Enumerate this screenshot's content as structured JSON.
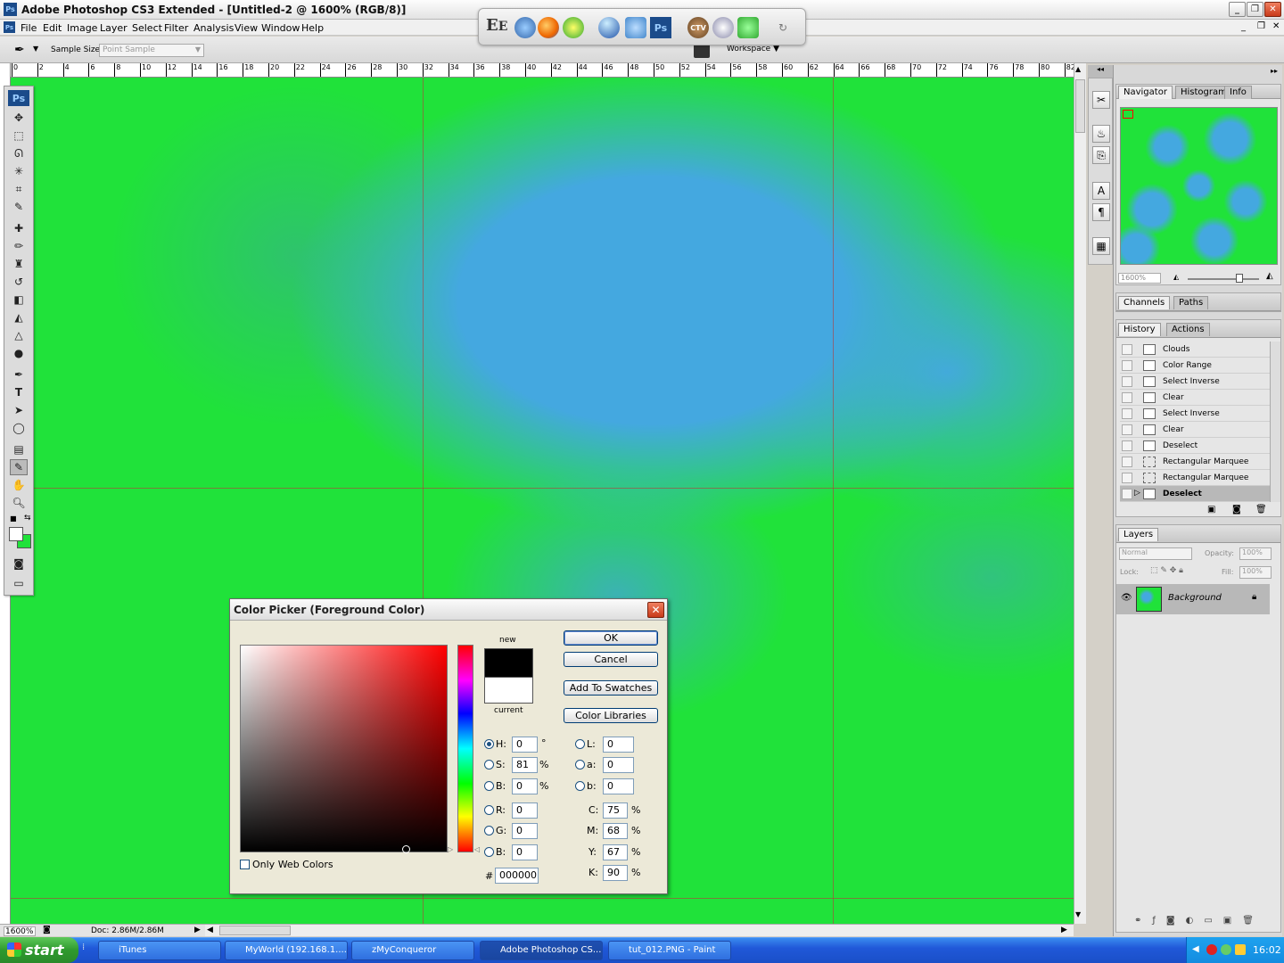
{
  "window": {
    "title": "Adobe Photoshop CS3 Extended - [Untitled-2 @ 1600% (RGB/8)]",
    "app_badge": "Ps"
  },
  "menu": [
    "File",
    "Edit",
    "Image",
    "Layer",
    "Select",
    "Filter",
    "Analysis",
    "View",
    "Window",
    "Help"
  ],
  "options": {
    "sample_size_label": "Sample Size:",
    "sample_size_value": "Point Sample",
    "workspace_label": "Workspace"
  },
  "quicklaunch": {
    "label": "Ps",
    "ctv": "CTV"
  },
  "ruler": {
    "marks": [
      "0",
      "2",
      "4",
      "6",
      "8",
      "10",
      "12",
      "14",
      "16",
      "18",
      "20",
      "22",
      "24",
      "26",
      "28",
      "30",
      "32",
      "34",
      "36",
      "38",
      "40",
      "42",
      "44",
      "46",
      "48",
      "50",
      "52",
      "54",
      "56",
      "58",
      "60",
      "62",
      "64",
      "66",
      "68",
      "70",
      "72",
      "74",
      "76",
      "78",
      "80",
      "82"
    ]
  },
  "canvas": {
    "colors": {
      "green": "#20e23a",
      "blue": "#44a8e0"
    }
  },
  "status": {
    "zoom": "1600%",
    "doc": "Doc: 2.86M/2.86M"
  },
  "toolbox": {
    "badge": "Ps"
  },
  "navigator": {
    "tabs": [
      "Navigator",
      "Histogram",
      "Info"
    ],
    "zoom": "1600%"
  },
  "channels": {
    "tabs": [
      "Channels",
      "Paths"
    ]
  },
  "history": {
    "tabs": [
      "History",
      "Actions"
    ],
    "items": [
      "Clouds",
      "Color Range",
      "Select Inverse",
      "Clear",
      "Select Inverse",
      "Clear",
      "Deselect",
      "Rectangular Marquee",
      "Rectangular Marquee",
      "Deselect"
    ],
    "selected_index": 9
  },
  "layers": {
    "tab": "Layers",
    "blend": "Normal",
    "opacity_label": "Opacity:",
    "opacity": "100%",
    "lock_label": "Lock:",
    "fill_label": "Fill:",
    "fill": "100%",
    "layer_name": "Background"
  },
  "colorpicker": {
    "title": "Color Picker (Foreground Color)",
    "new_label": "new",
    "current_label": "current",
    "ok": "OK",
    "cancel": "Cancel",
    "add_swatches": "Add To Swatches",
    "libraries": "Color Libraries",
    "only_web": "Only Web Colors",
    "hsb": [
      {
        "k": "H:",
        "v": "0",
        "u": "°"
      },
      {
        "k": "S:",
        "v": "81",
        "u": "%"
      },
      {
        "k": "B:",
        "v": "0",
        "u": "%"
      }
    ],
    "rgb": [
      {
        "k": "R:",
        "v": "0"
      },
      {
        "k": "G:",
        "v": "0"
      },
      {
        "k": "B:",
        "v": "0"
      }
    ],
    "lab": [
      {
        "k": "L:",
        "v": "0"
      },
      {
        "k": "a:",
        "v": "0"
      },
      {
        "k": "b:",
        "v": "0"
      }
    ],
    "cmyk": [
      {
        "k": "C:",
        "v": "75",
        "u": "%"
      },
      {
        "k": "M:",
        "v": "68",
        "u": "%"
      },
      {
        "k": "Y:",
        "v": "67",
        "u": "%"
      },
      {
        "k": "K:",
        "v": "90",
        "u": "%"
      }
    ],
    "hex_label": "#",
    "hex": "000000"
  },
  "taskbar": {
    "start": "start",
    "tasks": [
      "iTunes",
      "MyWorld (192.168.1....",
      "zMyConqueror",
      "Adobe Photoshop CS...",
      "tut_012.PNG - Paint"
    ],
    "active_index": 3,
    "clock": "16:02"
  }
}
